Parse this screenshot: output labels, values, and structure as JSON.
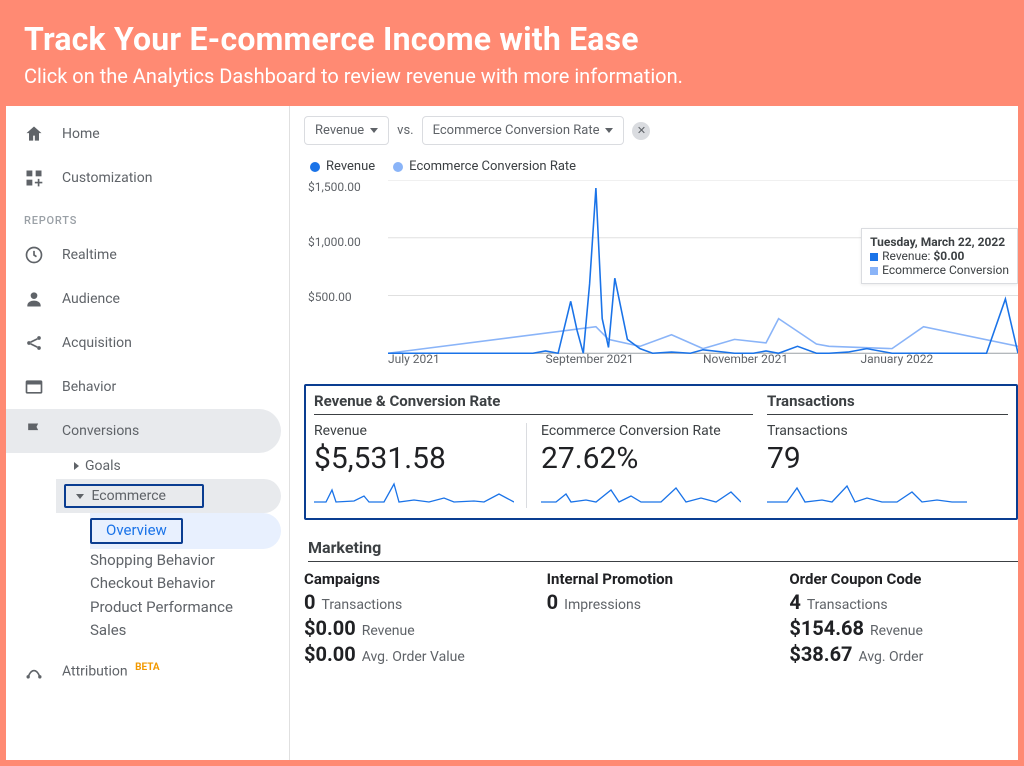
{
  "banner": {
    "title": "Track Your E-commerce Income with Ease",
    "subtitle": "Click on the Analytics Dashboard to review revenue with more information."
  },
  "sidebar": {
    "home": "Home",
    "customization": "Customization",
    "reports_header": "REPORTS",
    "realtime": "Realtime",
    "audience": "Audience",
    "acquisition": "Acquisition",
    "behavior": "Behavior",
    "conversions": "Conversions",
    "goals": "Goals",
    "ecommerce": "Ecommerce",
    "ecommerce_children": {
      "overview": "Overview",
      "shopping": "Shopping Behavior",
      "checkout": "Checkout Behavior",
      "product": "Product Performance",
      "sales": "Sales"
    },
    "attribution": "Attribution",
    "beta": "BETA"
  },
  "pickers": {
    "primary": "Revenue",
    "vs": "vs.",
    "secondary": "Ecommerce Conversion Rate"
  },
  "legend": {
    "a": "Revenue",
    "b": "Ecommerce Conversion Rate"
  },
  "chart_data": {
    "type": "line",
    "xlabel": "",
    "ylabel": "",
    "ylim": [
      0,
      1500
    ],
    "yticks": [
      "$1,500.00",
      "$1,000.00",
      "$500.00"
    ],
    "xticks": [
      "July 2021",
      "September 2021",
      "November 2021",
      "January 2022"
    ],
    "series": [
      {
        "name": "Revenue",
        "color": "#1a73e8",
        "x": [
          0,
          5,
          10,
          15,
          20,
          23,
          25,
          27,
          29,
          30,
          31,
          32,
          33,
          34,
          35,
          36,
          38,
          40,
          42,
          45,
          48,
          50,
          55,
          58,
          60,
          62,
          65,
          68,
          70,
          73,
          76,
          80,
          85,
          90,
          95,
          98,
          100
        ],
        "values": [
          0,
          0,
          0,
          0,
          0,
          0,
          20,
          0,
          450,
          200,
          0,
          600,
          1430,
          300,
          50,
          650,
          120,
          40,
          0,
          10,
          0,
          30,
          0,
          0,
          20,
          0,
          60,
          0,
          0,
          10,
          40,
          0,
          0,
          0,
          0,
          470,
          0
        ]
      },
      {
        "name": "Ecommerce Conversion Rate",
        "color": "#8ab4f8",
        "x": [
          0,
          33,
          35,
          40,
          45,
          50,
          55,
          60,
          62,
          68,
          70,
          80,
          85,
          100
        ],
        "values": [
          0,
          230,
          120,
          60,
          160,
          40,
          120,
          90,
          300,
          80,
          60,
          40,
          230,
          60
        ]
      }
    ],
    "tooltip": {
      "date": "Tuesday, March 22, 2022",
      "lines": [
        {
          "label": "Revenue:",
          "value": "$0.00",
          "color": "blue"
        },
        {
          "label": "Ecommerce Conversion",
          "value": "",
          "color": "lblue"
        }
      ]
    }
  },
  "cards": {
    "group1_title": "Revenue & Conversion Rate",
    "group2_title": "Transactions",
    "revenue_label": "Revenue",
    "revenue_value": "$5,531.58",
    "ecr_label": "Ecommerce Conversion Rate",
    "ecr_value": "27.62%",
    "trans_label": "Transactions",
    "trans_value": "79"
  },
  "marketing": {
    "title": "Marketing",
    "campaigns": {
      "title": "Campaigns",
      "v1": "0",
      "l1": "Transactions",
      "v2": "$0.00",
      "l2": "Revenue",
      "v3": "$0.00",
      "l3": "Avg. Order Value"
    },
    "internal": {
      "title": "Internal Promotion",
      "v1": "0",
      "l1": "Impressions"
    },
    "coupon": {
      "title": "Order Coupon Code",
      "v1": "4",
      "l1": "Transactions",
      "v2": "$154.68",
      "l2": "Revenue",
      "v3": "$38.67",
      "l3": "Avg. Order"
    }
  }
}
